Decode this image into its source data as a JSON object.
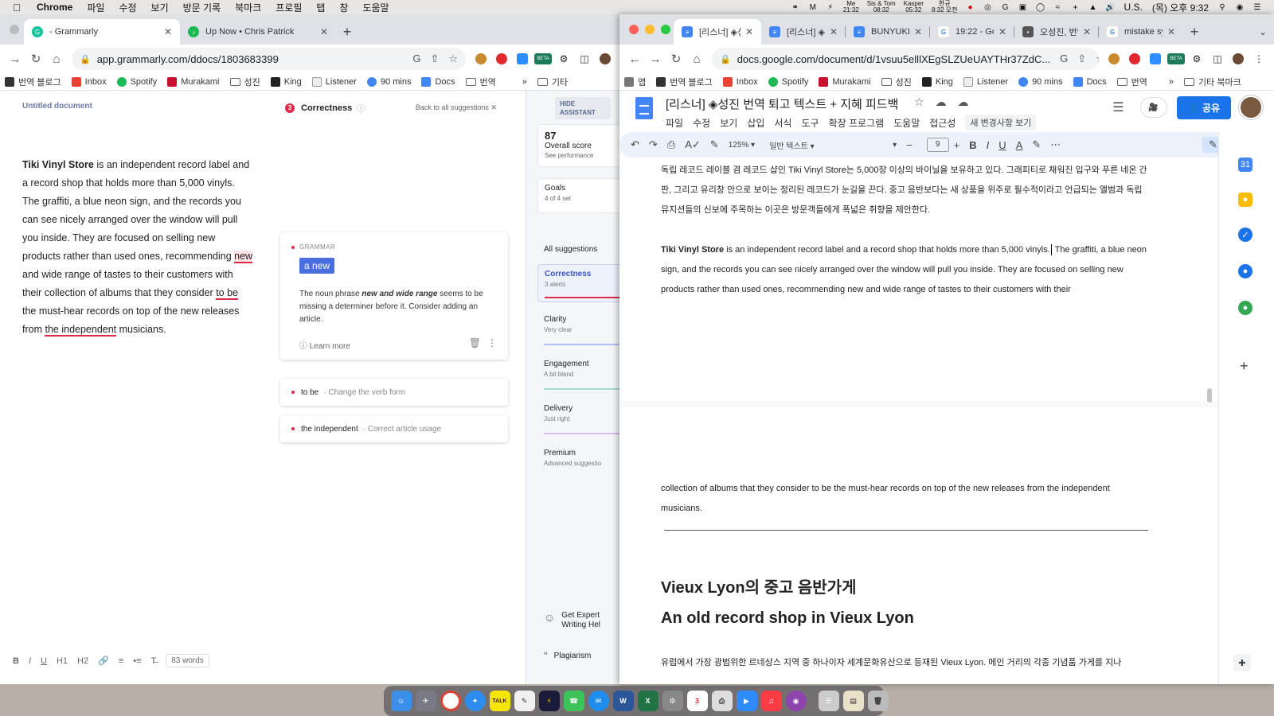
{
  "menubar": {
    "items": [
      "Chrome",
      "파일",
      "수정",
      "보기",
      "방문 기록",
      "북마크",
      "프로필",
      "탭",
      "창",
      "도움말"
    ],
    "clocks": [
      {
        "top": "Me",
        "bottom": "21:32"
      },
      {
        "top": "Sis & Tom",
        "bottom": "08:32"
      },
      {
        "top": "Kasper",
        "bottom": "05:32"
      },
      {
        "top": "한규",
        "bottom": "8:32 오전"
      }
    ],
    "input_source": "U.S.",
    "datetime": "(목) 오후 9:32"
  },
  "left_browser": {
    "tabs": [
      {
        "label": "- Grammarly",
        "active": true
      },
      {
        "label": "Up Now • Chris Patrick",
        "active": false
      }
    ],
    "url": "app.grammarly.com/ddocs/1803683399",
    "bookmarks": [
      "번역 블로그",
      "Inbox",
      "Spotify",
      "Murakami",
      "성진",
      "King",
      "Listener",
      "90 mins",
      "Docs",
      "번역",
      "기타"
    ],
    "ext_badge": "BETA"
  },
  "grammarly": {
    "doc_title": "Untitled document",
    "text": {
      "store": "Tiki Vinyl Store",
      "part1": " is an independent record label and a record shop that holds more than 5,000 vinyls. The graffiti, a blue neon sign, and the records you can see nicely arranged over the window will pull you inside. They are focused on selling new products rather than used ones, recommending ",
      "hl1": "new",
      "part2": " and wide range of tastes to their customers with their collection of albums that they consider ",
      "hl2": "to be",
      "part3": " the must-hear records on top of the new releases from ",
      "hl3": "the independent",
      "part4": " musicians."
    },
    "correctness_count": "3",
    "correctness_label": "Correctness",
    "back_label": "Back to all suggestions",
    "card": {
      "type": "GRAMMAR",
      "suggestion": "a new",
      "desc_pre": "The noun phrase ",
      "desc_em": "new and wide range",
      "desc_post": " seems to be missing a determiner before it. Consider adding an article.",
      "learn_more": "Learn more"
    },
    "other_suggestions": [
      {
        "word": "to be",
        "hint": "Change the verb form"
      },
      {
        "word": "the independent",
        "hint": "Correct article usage"
      }
    ],
    "footer": {
      "h1": "H1",
      "h2": "H2",
      "word_count": "83 words"
    },
    "side": {
      "hide_assistant": "HIDE ASSISTANT",
      "score": "87",
      "score_label": "Overall score",
      "score_sub": "See performance",
      "goals": "Goals",
      "goals_sub": "4 of 4 set",
      "all_suggestions": "All suggestions",
      "categories": [
        {
          "label": "Correctness",
          "sub": "3 alerts"
        },
        {
          "label": "Clarity",
          "sub": "Very clear"
        },
        {
          "label": "Engagement",
          "sub": "A bit bland"
        },
        {
          "label": "Delivery",
          "sub": "Just right"
        },
        {
          "label": "Premium",
          "sub": "Advanced suggestio"
        }
      ],
      "expert": "Get Expert Writing Hel",
      "plagiarism": "Plagiarism"
    }
  },
  "right_browser": {
    "tabs": [
      {
        "label": "[리스너] ◈성",
        "active": true
      },
      {
        "label": "[리스너] ◈성",
        "active": false
      },
      {
        "label": "BUNYUKLO",
        "active": false
      },
      {
        "label": "19:22 - Goo",
        "active": false
      },
      {
        "label": "오성진, 번역,",
        "active": false
      },
      {
        "label": "mistake sy",
        "active": false
      }
    ],
    "url": "docs.google.com/document/d/1vsuu5elllXEgSLZUeUAYTHr37ZdC...",
    "bookmarks": [
      "앱",
      "번역 블로그",
      "Inbox",
      "Spotify",
      "Murakami",
      "성진",
      "King",
      "Listener",
      "90 mins",
      "Docs",
      "번역",
      "기타 북마크"
    ],
    "ext_badge": "BETA"
  },
  "docs": {
    "title": "[리스너] ◈성진 번역 퇴고 텍스트 + 지혜 피드백",
    "menu": [
      "파일",
      "수정",
      "보기",
      "삽입",
      "서식",
      "도구",
      "확장 프로그램",
      "도움말",
      "접근성"
    ],
    "changes_label": "새 변경사항 보기",
    "share_label": "공유",
    "toolbar": {
      "zoom": "125%",
      "style": "일반 텍스트",
      "font_size": "9"
    },
    "p1_korean": "독립 레코드 레이블 겸 레코드 샵인 Tiki Vinyl Store는 5,000장 이상의 바이닐을 보유하고 있다. 그래피티로 채워진 입구와 푸른 네온 간판, 그리고 유리창 안으로 보이는 정리된 레코드가 눈길을 끈다. 중고 음반보다는 새 상품을 위주로 필수적이라고 언급되는 앨범과 독립 뮤지션들의 신보에 주목하는 이곳은 방문객들에게 폭넓은 취향을 제안한다.",
    "p1_en_store": "Tiki Vinyl Store",
    "p1_en_a": " is an independent record label and a record shop that holds more than 5,000 vinyls.",
    "p1_en_b": " The graffiti, a blue neon sign, and the records you can see nicely arranged over the window will pull you inside. They are focused on selling new products rather than used ones, recommending new and wide range of tastes to their customers with their",
    "p2_en": "collection of albums that they consider to be the must-hear records on top of the new releases from the independent musicians.",
    "h1_korean": "Vieux Lyon의 중고 음반가게",
    "h1_english": "An old record shop in Vieux Lyon",
    "p2_korean": "유럽에서 가장 광범위한 르네상스 지역 중 하나이자 세계문화유산으로 등재된 Vieux Lyon. 메인 거리의 각종 기념품 가게를 지나"
  },
  "dock": {
    "talk_label": "TALK",
    "talk_badge": "1",
    "calendar_day": "3",
    "podcast_badge": "1"
  }
}
